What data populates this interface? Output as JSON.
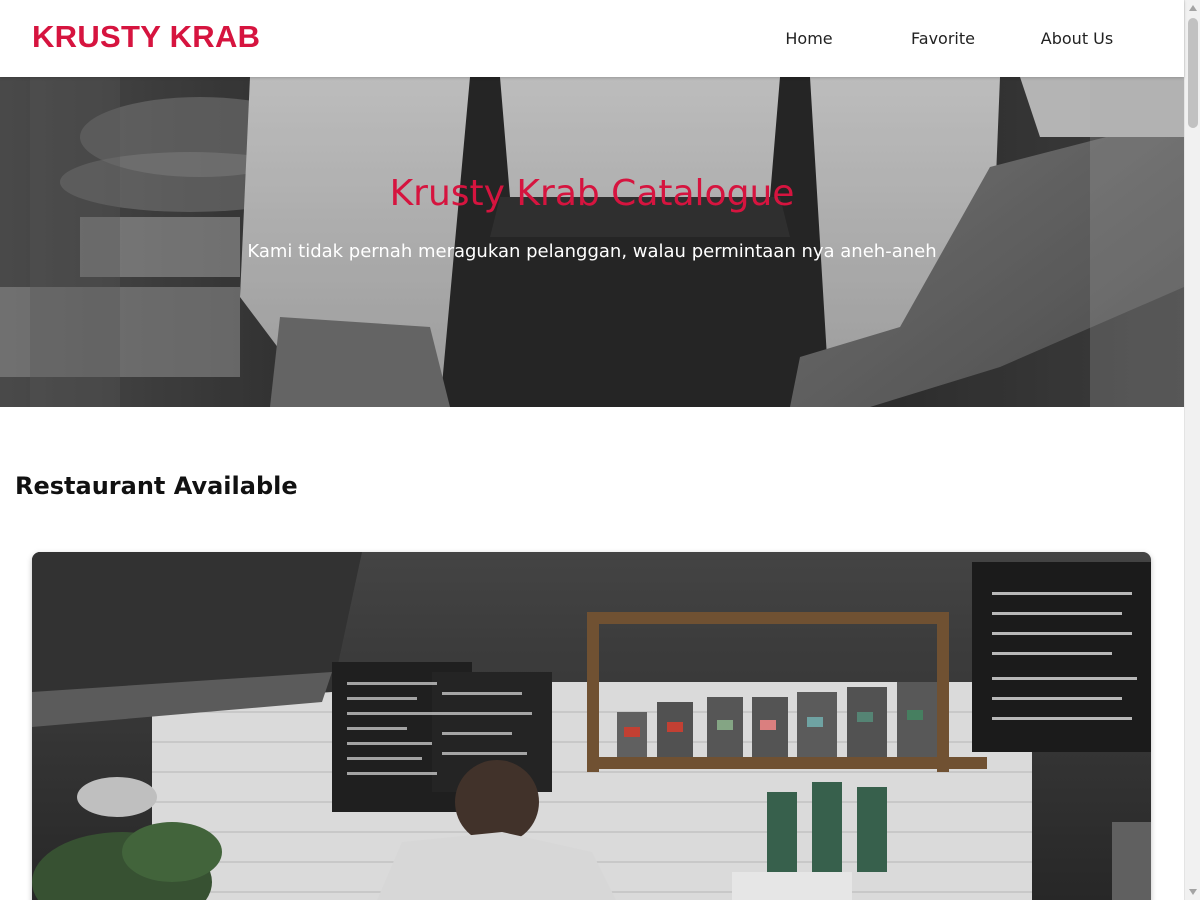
{
  "header": {
    "brand": "KRUSTY KRAB",
    "nav": [
      "Home",
      "Favorite",
      "About Us"
    ]
  },
  "hero": {
    "title": "Krusty Krab Catalogue",
    "tagline": "Kami tidak pernah meragukan pelanggan, walau permintaan nya aneh-aneh",
    "image": "chef-in-apron-photo"
  },
  "main": {
    "section_title": "Restaurant Available",
    "restaurant_card": {
      "image": "cafe-counter-photo"
    }
  },
  "colors": {
    "accent": "#d6143f",
    "nav_text": "#222222",
    "background": "#ffffff"
  },
  "scrollbar": {
    "position_fraction": 0.0
  }
}
